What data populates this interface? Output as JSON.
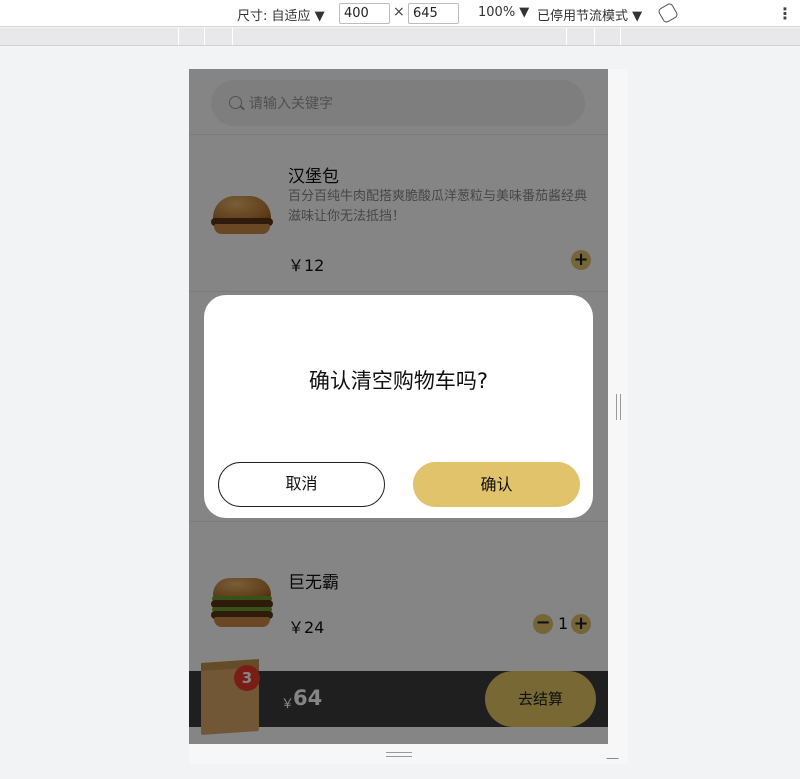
{
  "devtools": {
    "size_label": "尺寸: 自适应 ▼",
    "width": "400",
    "height": "645",
    "times": "×",
    "zoom": "100% ▼",
    "throttle": "已停用节流模式 ▼",
    "more": "⋮"
  },
  "search": {
    "placeholder": "请输入关键字"
  },
  "menu": {
    "items": [
      {
        "name": "汉堡包",
        "description": "百分百纯牛肉配搭爽脆酸瓜洋葱粒与美味番茄酱经典滋味让你无法抵挡！",
        "price": "￥12",
        "add": "+"
      },
      {
        "name": "巨无霸",
        "price": "￥24",
        "minus": "−",
        "quantity": "1",
        "add": "+"
      }
    ]
  },
  "cart": {
    "badge": "3",
    "currency": "￥",
    "total": "64",
    "checkout_label": "去结算"
  },
  "dialog": {
    "title": "确认清空购物车吗?",
    "cancel_label": "取消",
    "confirm_label": "确认"
  },
  "colors": {
    "accent": "#e0c36a",
    "badge": "#e93b2c",
    "cart_bar": "#3c3c3c"
  }
}
